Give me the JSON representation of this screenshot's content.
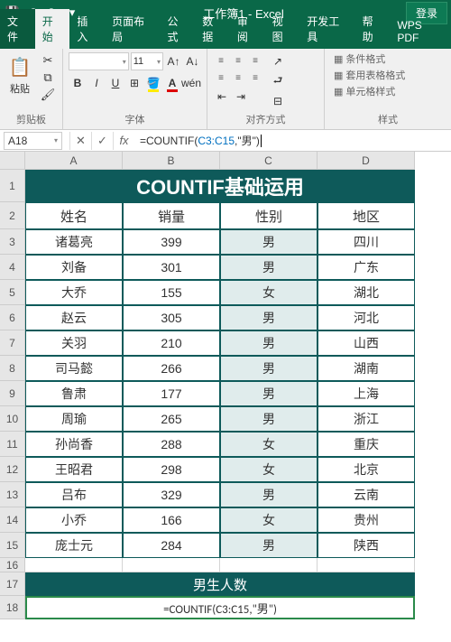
{
  "titlebar": {
    "title": "工作簿1 - Excel",
    "login": "登录"
  },
  "menu": {
    "file": "文件",
    "home": "开始",
    "insert": "插入",
    "layout": "页面布局",
    "formulas": "公式",
    "data": "数据",
    "review": "审阅",
    "view": "视图",
    "dev": "开发工具",
    "help": "帮助",
    "wps": "WPS PDF"
  },
  "ribbon": {
    "font_name": "",
    "font_size": "11",
    "group_clipboard": "剪贴板",
    "group_font": "字体",
    "group_align": "对齐方式",
    "group_styles": "样式",
    "paste": "粘贴",
    "cond_format": "条件格式",
    "table_format": "套用表格格式",
    "cell_styles": "单元格样式"
  },
  "namebox": "A18",
  "formula": {
    "pre": "=COUNTIF(",
    "ref": "C3:C15",
    "post": ",\"男\")"
  },
  "columns": [
    "A",
    "B",
    "C",
    "D"
  ],
  "table": {
    "title": "COUNTIF基础运用",
    "headers": [
      "姓名",
      "销量",
      "性别",
      "地区"
    ],
    "rows": [
      [
        "诸葛亮",
        "399",
        "男",
        "四川"
      ],
      [
        "刘备",
        "301",
        "男",
        "广东"
      ],
      [
        "大乔",
        "155",
        "女",
        "湖北"
      ],
      [
        "赵云",
        "305",
        "男",
        "河北"
      ],
      [
        "关羽",
        "210",
        "男",
        "山西"
      ],
      [
        "司马懿",
        "266",
        "男",
        "湖南"
      ],
      [
        "鲁肃",
        "177",
        "男",
        "上海"
      ],
      [
        "周瑜",
        "265",
        "男",
        "浙江"
      ],
      [
        "孙尚香",
        "288",
        "女",
        "重庆"
      ],
      [
        "王昭君",
        "298",
        "女",
        "北京"
      ],
      [
        "吕布",
        "329",
        "男",
        "云南"
      ],
      [
        "小乔",
        "166",
        "女",
        "贵州"
      ],
      [
        "庞士元",
        "284",
        "男",
        "陕西"
      ]
    ],
    "count_label": "男生人数",
    "count_formula": "=COUNTIF(C3:C15,\"男\")"
  }
}
